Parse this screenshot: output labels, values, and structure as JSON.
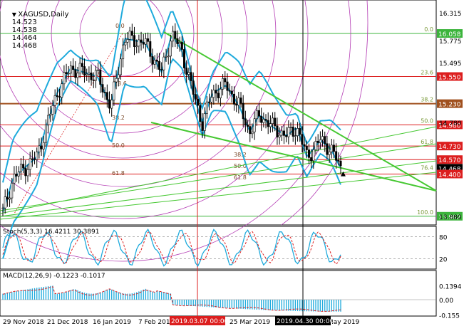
{
  "chart_data": [
    {
      "type": "candlestick",
      "title": "XAGUSD,Daily",
      "ohlc_readout": [
        "14.523",
        "14.538",
        "14.464",
        "14.468"
      ],
      "ylim": [
        13.79,
        16.5
      ],
      "y_ticks": [
        "16.315",
        "15.775",
        "15.495",
        "14.780",
        "13.880"
      ],
      "x_ticks": [
        "29 Nov 2018",
        "21 Dec 2018",
        "16 Jan 2019",
        "7 Feb 2019",
        "25 Mar 2019",
        "May 2019"
      ],
      "x_markers": [
        "2019.03.07 00:00",
        "2019.04.30 00:00"
      ],
      "price_levels": [
        {
          "value": 16.058,
          "label": "16.058",
          "fib": "0.0",
          "color": "#3cb43c"
        },
        {
          "value": 15.55,
          "label": "15.550",
          "fib": "23.6",
          "color": "#dc1e1e"
        },
        {
          "value": 15.23,
          "label": "15.230",
          "fib": "38.2",
          "color": "#a0501e"
        },
        {
          "value": 14.98,
          "label": "14.980",
          "fib": "50.0",
          "color": "#dc1e1e"
        },
        {
          "value": 14.73,
          "label": "14.730",
          "fib": "61.8",
          "color": "#dc1e1e"
        },
        {
          "value": 14.57,
          "label": "14.570",
          "fib": "",
          "color": "#dc1e1e"
        },
        {
          "value": 14.468,
          "label": "14.468",
          "fib": "76.4",
          "color": "#000000"
        },
        {
          "value": 14.4,
          "label": "14.400",
          "fib": "",
          "color": "#dc1e1e"
        },
        {
          "value": 13.902,
          "label": "13.902",
          "fib": "100.0",
          "color": "#3cb43c"
        }
      ],
      "fib_fan_labels": [
        "0.0",
        "23.6",
        "38.2",
        "50.0",
        "61.8",
        "38.2",
        "50.0",
        "61.8"
      ],
      "fan_labels": [
        "38.2",
        "50.0",
        "61.8"
      ],
      "colors": {
        "bollinger": "#1eaadc",
        "trend": "#46c832",
        "fib_arcs": "#b43cb4",
        "candles": "#000000"
      }
    },
    {
      "type": "line",
      "title": "Stoch(5,3,3) 16.4211 30.3891",
      "y_ticks": [
        "80",
        "20"
      ],
      "colors": {
        "main": "#1eaadc",
        "signal": "#dc1e1e"
      }
    },
    {
      "type": "bar",
      "title": "MACD(12,26,9) -0.1223 -0.1017",
      "y_ticks": [
        "0.1394",
        "0.00",
        "-0.155"
      ],
      "colors": {
        "histogram": "#1eaadc",
        "signal": "#dc1e1e"
      }
    }
  ]
}
